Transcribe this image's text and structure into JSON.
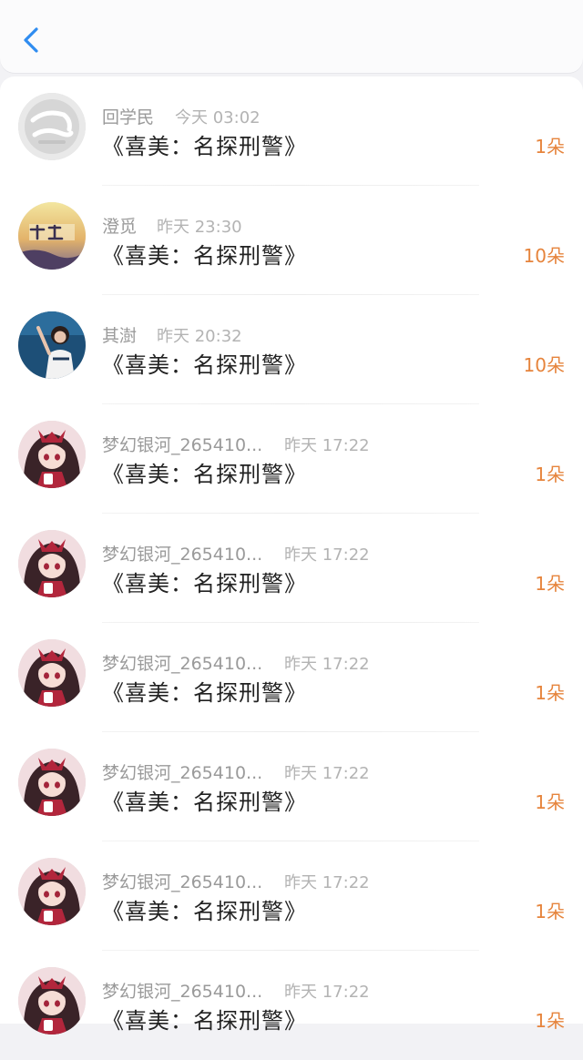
{
  "header": {
    "back_icon": "chevron-left-icon",
    "accent_color": "#2f8cf0"
  },
  "list": {
    "items": [
      {
        "username": "回学民",
        "time": "今天 03:02",
        "title": "《喜美：名探刑警》",
        "amount": "1朵",
        "avatar": "avatar-white-logo"
      },
      {
        "username": "澄觅",
        "time": "昨天 23:30",
        "title": "《喜美：名探刑警》",
        "amount": "10朵",
        "avatar": "avatar-responsibility"
      },
      {
        "username": "其澍",
        "time": "昨天 20:32",
        "title": "《喜美：名探刑警》",
        "amount": "10朵",
        "avatar": "avatar-girl-sky"
      },
      {
        "username": "梦幻银河_265410...",
        "time": "昨天 17:22",
        "title": "《喜美：名探刑警》",
        "amount": "1朵",
        "avatar": "avatar-anime-girl"
      },
      {
        "username": "梦幻银河_265410...",
        "time": "昨天 17:22",
        "title": "《喜美：名探刑警》",
        "amount": "1朵",
        "avatar": "avatar-anime-girl"
      },
      {
        "username": "梦幻银河_265410...",
        "time": "昨天 17:22",
        "title": "《喜美：名探刑警》",
        "amount": "1朵",
        "avatar": "avatar-anime-girl"
      },
      {
        "username": "梦幻银河_265410...",
        "time": "昨天 17:22",
        "title": "《喜美：名探刑警》",
        "amount": "1朵",
        "avatar": "avatar-anime-girl"
      },
      {
        "username": "梦幻银河_265410...",
        "time": "昨天 17:22",
        "title": "《喜美：名探刑警》",
        "amount": "1朵",
        "avatar": "avatar-anime-girl"
      },
      {
        "username": "梦幻银河_265410...",
        "time": "昨天 17:22",
        "title": "《喜美：名探刑警》",
        "amount": "1朵",
        "avatar": "avatar-anime-girl"
      }
    ]
  },
  "colors": {
    "amount": "#e6843c",
    "username": "#9a9a9a",
    "time": "#b3b3b3",
    "title": "#222222"
  }
}
